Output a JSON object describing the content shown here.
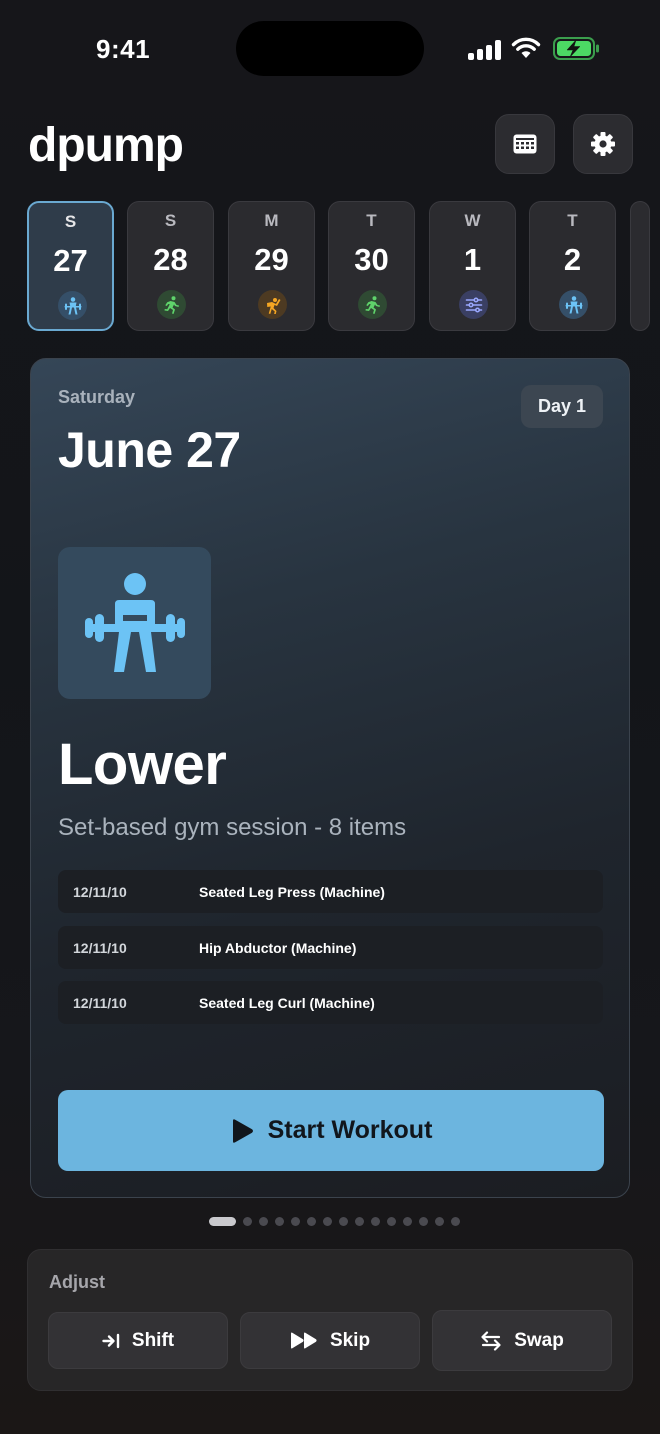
{
  "status_bar": {
    "time": "9:41",
    "icons": [
      "cellular-signal-icon",
      "wifi-icon",
      "battery-charging-icon"
    ],
    "battery_color": "#4cd964"
  },
  "header": {
    "title": "dpump",
    "buttons": [
      "calendar-icon",
      "gear-icon"
    ]
  },
  "day_strip": [
    {
      "letter": "S",
      "number": "27",
      "icon": "weightlifting-icon",
      "icon_color": "#6cc3f5",
      "selected": true
    },
    {
      "letter": "S",
      "number": "28",
      "icon": "running-icon",
      "icon_color": "#5fd36b",
      "selected": false
    },
    {
      "letter": "M",
      "number": "29",
      "icon": "climbing-icon",
      "icon_color": "#f5a623",
      "selected": false
    },
    {
      "letter": "T",
      "number": "30",
      "icon": "running-icon",
      "icon_color": "#5fd36b",
      "selected": false
    },
    {
      "letter": "W",
      "number": "1",
      "icon": "sliders-icon",
      "icon_color": "#9aa8ff",
      "selected": false
    },
    {
      "letter": "T",
      "number": "2",
      "icon": "weightlifting-icon",
      "icon_color": "#6cc3f5",
      "selected": false
    }
  ],
  "workout_card": {
    "weekday": "Saturday",
    "date": "June 27",
    "day_badge": "Day 1",
    "icon": "weightlifting-icon",
    "title": "Lower",
    "subtitle": "Set-based gym session - 8 items",
    "exercises": [
      {
        "sets": "12/11/10",
        "name": "Seated Leg Press (Machine)"
      },
      {
        "sets": "12/11/10",
        "name": "Hip Abductor (Machine)"
      },
      {
        "sets": "12/11/10",
        "name": "Seated Leg Curl (Machine)"
      }
    ],
    "start_button": "Start Workout",
    "accent_color": "#6cb5df"
  },
  "pagination": {
    "total": 15,
    "current": 1
  },
  "adjust": {
    "label": "Adjust",
    "shift": "Shift",
    "skip": "Skip",
    "swap": "Swap"
  }
}
